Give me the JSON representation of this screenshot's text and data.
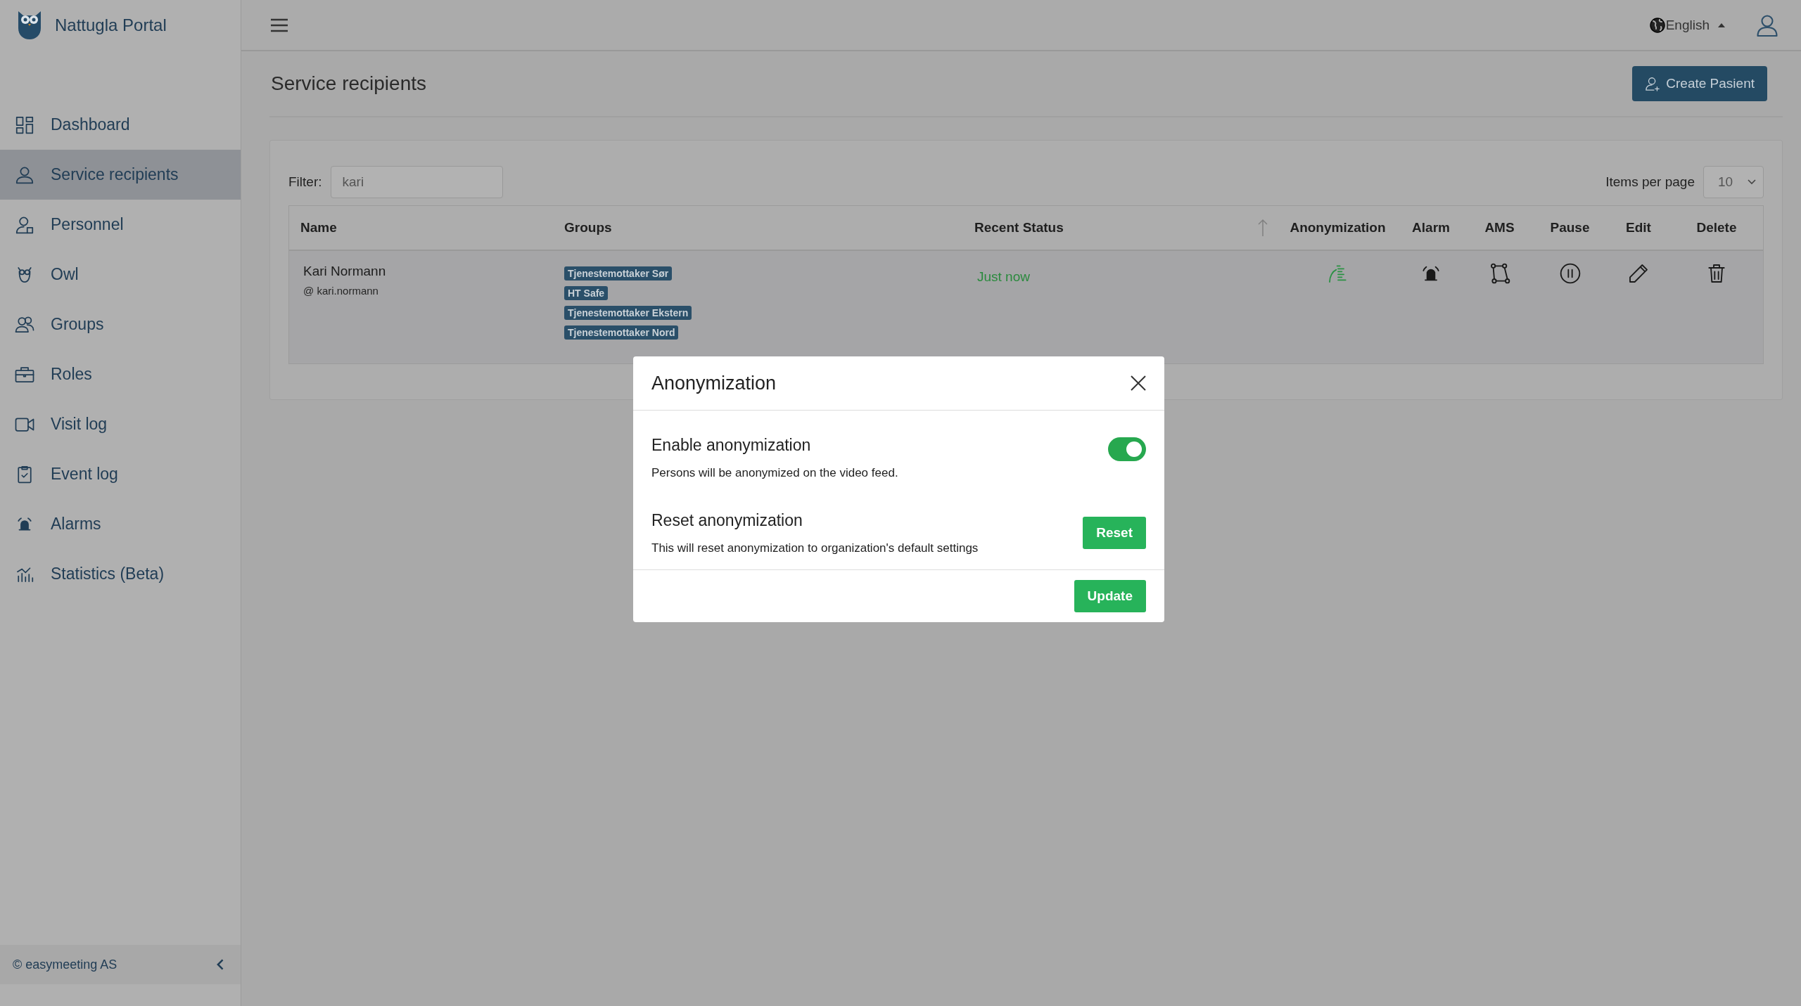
{
  "app": {
    "title": "Nattugla Portal"
  },
  "sidebar": {
    "items": [
      {
        "label": "Dashboard",
        "selected": false
      },
      {
        "label": "Service recipients",
        "selected": true
      },
      {
        "label": "Personnel",
        "selected": false
      },
      {
        "label": "Owl",
        "selected": false
      },
      {
        "label": "Groups",
        "selected": false
      },
      {
        "label": "Roles",
        "selected": false
      },
      {
        "label": "Visit log",
        "selected": false
      },
      {
        "label": "Event log",
        "selected": false
      },
      {
        "label": "Alarms",
        "selected": false
      },
      {
        "label": "Statistics (Beta)",
        "selected": false
      }
    ],
    "footer": "© easymeeting AS"
  },
  "header": {
    "language": "English"
  },
  "page": {
    "title": "Service recipients",
    "create_button": "Create Pasient"
  },
  "filter": {
    "label": "Filter:",
    "value": "kari"
  },
  "items_per_page": {
    "label": "Items per page",
    "value": "10"
  },
  "table": {
    "columns": [
      {
        "label": "Name",
        "sorted": false
      },
      {
        "label": "Groups",
        "sorted": false
      },
      {
        "label": "Recent Status",
        "sorted": true
      },
      {
        "label": "Anonymization",
        "sorted": false
      },
      {
        "label": "Alarm",
        "sorted": false
      },
      {
        "label": "AMS",
        "sorted": false
      },
      {
        "label": "Pause",
        "sorted": false
      },
      {
        "label": "Edit",
        "sorted": false
      },
      {
        "label": "Delete",
        "sorted": false
      }
    ],
    "rows": [
      {
        "name": "Kari Normann",
        "username": "@ kari.normann",
        "groups": [
          "Tjenestemottaker Sør",
          "HT Safe",
          "Tjenestemottaker Ekstern",
          "Tjenestemottaker Nord"
        ],
        "recent_status": "Just now",
        "anonymization": true
      }
    ]
  },
  "modal": {
    "title": "Anonymization",
    "sections": [
      {
        "kind": "toggle",
        "title": "Enable anonymization",
        "description": "Persons will be anonymized on the video feed.",
        "on": true
      },
      {
        "kind": "action",
        "title": "Reset anonymization",
        "description": "This will reset anonymization to organization's default settings",
        "button": "Reset"
      }
    ],
    "footer_button": "Update"
  }
}
